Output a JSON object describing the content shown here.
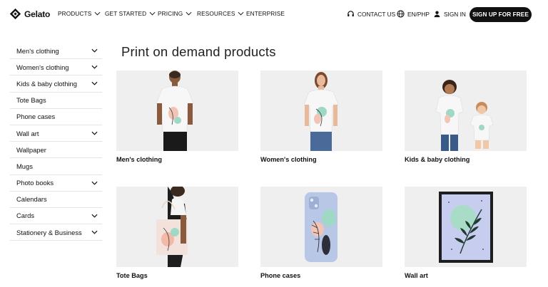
{
  "nav": {
    "logo_text": "Gelato",
    "items": [
      {
        "label": "PRODUCTS",
        "has_dropdown": true
      },
      {
        "label": "GET STARTED",
        "has_dropdown": true
      },
      {
        "label": "PRICING",
        "has_dropdown": true
      },
      {
        "label": "RESOURCES",
        "has_dropdown": true
      },
      {
        "label": "ENTERPRISE",
        "has_dropdown": false
      }
    ],
    "contact_label": "CONTACT US",
    "locale_label": "EN/PHP",
    "signin_label": "SIGN IN",
    "signup_label": "SIGN UP FOR FREE"
  },
  "sidebar": {
    "items": [
      {
        "label": "Men's clothing",
        "expandable": true
      },
      {
        "label": "Women's clothing",
        "expandable": true
      },
      {
        "label": "Kids & baby clothing",
        "expandable": true
      },
      {
        "label": "Tote Bags",
        "expandable": false
      },
      {
        "label": "Phone cases",
        "expandable": false
      },
      {
        "label": "Wall art",
        "expandable": true
      },
      {
        "label": "Wallpaper",
        "expandable": false
      },
      {
        "label": "Mugs",
        "expandable": false
      },
      {
        "label": "Photo books",
        "expandable": true
      },
      {
        "label": "Calendars",
        "expandable": false
      },
      {
        "label": "Cards",
        "expandable": true
      },
      {
        "label": "Stationery & Business",
        "expandable": true
      }
    ]
  },
  "main": {
    "title": "Print on demand products",
    "products": [
      {
        "label": "Men's clothing",
        "image": "man-tshirt-image"
      },
      {
        "label": "Women's clothing",
        "image": "woman-tshirt-image"
      },
      {
        "label": "Kids & baby clothing",
        "image": "kids-clothing-image"
      },
      {
        "label": "Tote Bags",
        "image": "tote-bag-image"
      },
      {
        "label": "Phone cases",
        "image": "phone-case-image"
      },
      {
        "label": "Wall art",
        "image": "wall-art-image"
      }
    ]
  },
  "colors": {
    "accent": "#111111",
    "card_bg": "#efefef",
    "divider": "#e4e4e4"
  }
}
